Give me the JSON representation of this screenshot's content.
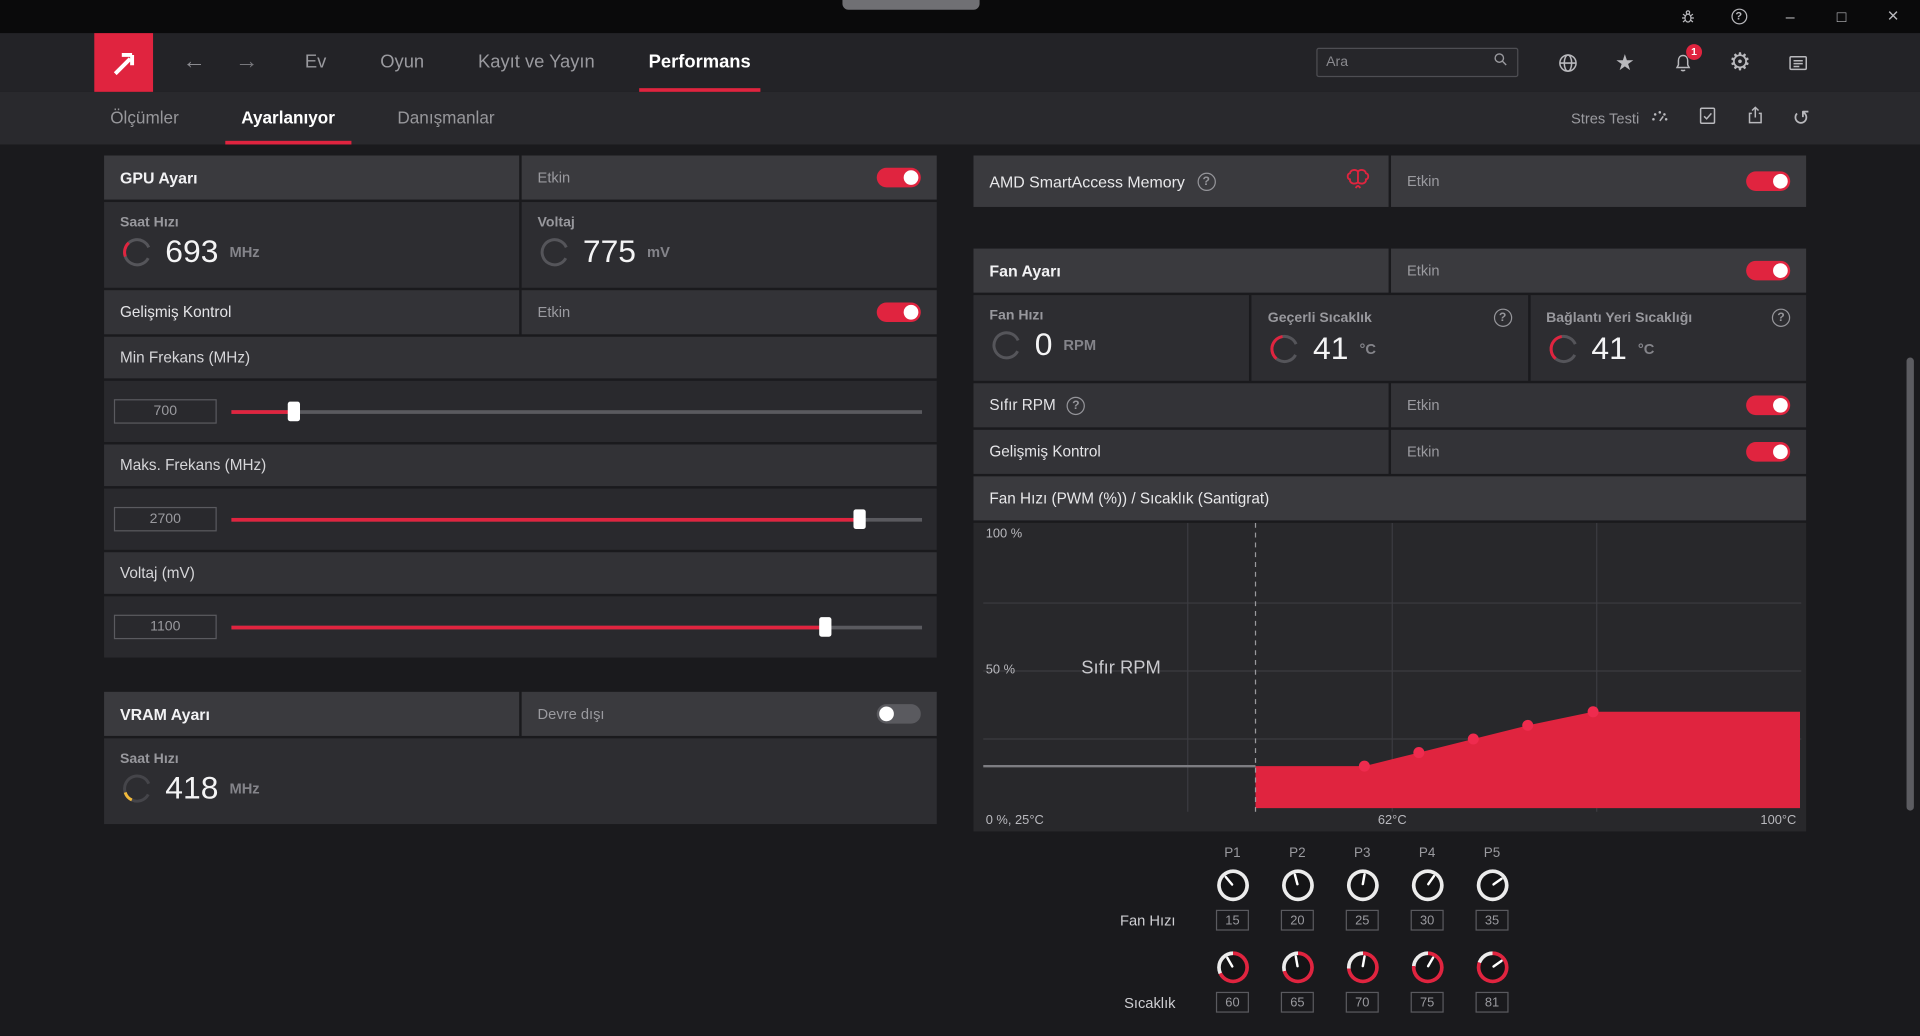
{
  "colors": {
    "accent": "#e0243f",
    "vram_warning": "#f0b93c",
    "chart_fill": "#e0243f",
    "chart_point": "#ef2b4e"
  },
  "icons": {
    "back": "←",
    "forward": "→",
    "star": "★",
    "gear": "⚙",
    "reset": "↺",
    "minimize": "–",
    "maximize": "□",
    "close": "×",
    "help": "?"
  },
  "navbar": {
    "items": [
      {
        "label": "Ev"
      },
      {
        "label": "Oyun"
      },
      {
        "label": "Kayıt ve Yayın"
      },
      {
        "label": "Performans"
      }
    ],
    "active_item": "Performans",
    "search_placeholder": "Ara",
    "notification_count": "1"
  },
  "subnav": {
    "items": [
      {
        "label": "Ölçümler"
      },
      {
        "label": "Ayarlanıyor"
      },
      {
        "label": "Danışmanlar"
      }
    ],
    "active_item": "Ayarlanıyor",
    "stress_test_label": "Stres Testi"
  },
  "gpu_card": {
    "title": "GPU Ayarı",
    "status": "Etkin",
    "clock": {
      "label": "Saat Hızı",
      "value": "693",
      "unit": "MHz"
    },
    "voltage": {
      "label": "Voltaj",
      "value": "775",
      "unit": "mV"
    },
    "advanced": {
      "label": "Gelişmiş Kontrol",
      "status": "Etkin"
    },
    "sliders": [
      {
        "label": "Min Frekans (MHz)",
        "value": "700",
        "percent": 9
      },
      {
        "label": "Maks. Frekans (MHz)",
        "value": "2700",
        "percent": 91
      },
      {
        "label": "Voltaj (mV)",
        "value": "1100",
        "percent": 86
      }
    ]
  },
  "vram_card": {
    "title": "VRAM Ayarı",
    "status": "Devre dışı",
    "clock": {
      "label": "Saat Hızı",
      "value": "418",
      "unit": "MHz"
    }
  },
  "sam_card": {
    "title": "AMD SmartAccess Memory",
    "status": "Etkin"
  },
  "fan_card": {
    "title": "Fan Ayarı",
    "status": "Etkin",
    "metrics": [
      {
        "label": "Fan Hızı",
        "value": "0",
        "unit": "RPM"
      },
      {
        "label": "Geçerli Sıcaklık",
        "value": "41",
        "unit": "°C"
      },
      {
        "label": "Bağlantı Yeri Sıcaklığı",
        "value": "41",
        "unit": "°C"
      }
    ],
    "zero_rpm": {
      "label": "Sıfır RPM",
      "status": "Etkin"
    },
    "advanced": {
      "label": "Gelişmiş Kontrol",
      "status": "Etkin"
    },
    "chart_header": "Fan Hızı (PWM (%)) / Sıcaklık (Santigrat)"
  },
  "chart_data": {
    "type": "area",
    "title": "Fan Hızı (PWM (%)) / Sıcaklık (Santigrat)",
    "xlabel": "Sıcaklık (Santigrat)",
    "ylabel": "Fan Hızı (PWM (%))",
    "x": [
      60,
      65,
      70,
      75,
      81
    ],
    "values": [
      15,
      20,
      25,
      30,
      35
    ],
    "point_labels": [
      "P1",
      "P2",
      "P3",
      "P4",
      "P5"
    ],
    "xlim": [
      25,
      100
    ],
    "ylim": [
      0,
      100
    ],
    "zero_rpm_boundary": 50,
    "grid": true,
    "annotations": {
      "zero_rpm": "Sıfır RPM"
    },
    "y_tick_labels": [
      "100 %",
      "50 %"
    ],
    "x_axis_labels": [
      "0 %, 25°C",
      "62°C",
      "100°C"
    ],
    "fill_color": "#e0243f",
    "point_color": "#ef2b4e"
  },
  "curve_editor": {
    "headers": [
      "P1",
      "P2",
      "P3",
      "P4",
      "P5"
    ],
    "fan_row_label": "Fan Hızı",
    "fan_values": [
      "15",
      "20",
      "25",
      "30",
      "35"
    ],
    "temp_row_label": "Sıcaklık",
    "temp_values": [
      "60",
      "65",
      "70",
      "75",
      "81"
    ]
  }
}
